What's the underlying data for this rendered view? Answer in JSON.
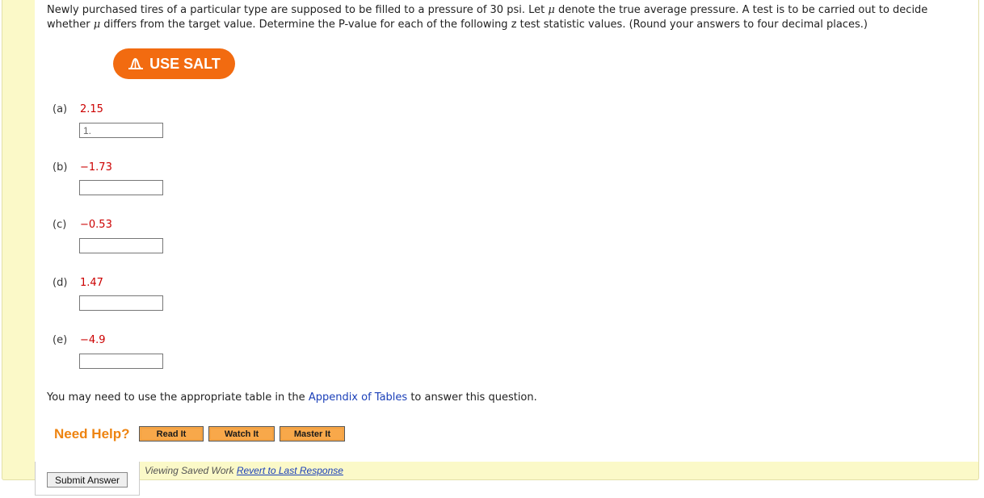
{
  "question": {
    "intro": "Newly purchased tires of a particular type are supposed to be filled to a pressure of 30 psi. Let ",
    "mu1": "μ",
    "mid": " denote the true average pressure. A test is to be carried out to decide whether ",
    "mu2": "μ",
    "outro": " differs from the target value. Determine the P-value for each of the following z test statistic values. (Round your answers to four decimal places.)"
  },
  "salt": {
    "label": "USE SALT",
    "icon": "salt-curve-icon"
  },
  "parts": [
    {
      "label": "(a)",
      "value": "2.15",
      "answer": "1."
    },
    {
      "label": "(b)",
      "value": "−1.73",
      "answer": ""
    },
    {
      "label": "(c)",
      "value": "−0.53",
      "answer": ""
    },
    {
      "label": "(d)",
      "value": "1.47",
      "answer": ""
    },
    {
      "label": "(e)",
      "value": "−4.9",
      "answer": ""
    }
  ],
  "appendix": {
    "prefix": "You may need to use the appropriate table in the ",
    "link": "Appendix of Tables",
    "suffix": " to answer this question."
  },
  "help": {
    "title": "Need Help?",
    "read": "Read It",
    "watch": "Watch It",
    "master": "Master It"
  },
  "footer": {
    "submit": "Submit Answer",
    "saved": "Viewing Saved Work ",
    "revert": "Revert to Last Response"
  },
  "colors": {
    "accent_orange": "#f26b10",
    "value_red": "#cc0000",
    "frame_yellow": "#fbf9c8",
    "help_button": "#f8a84a",
    "link_blue": "#1a3fb8"
  }
}
